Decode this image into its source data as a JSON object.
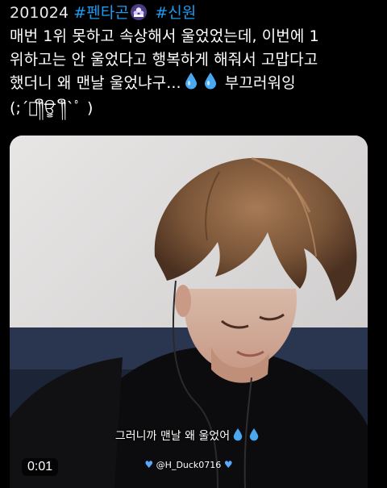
{
  "tweet": {
    "date": "201024",
    "hashtag_1": "#펜타곤",
    "hashtag_2": "#신원",
    "line_2": "매번 1위 못하고 속상해서 울었었는데, 이번에 1",
    "line_3": "위하고는 안 울었다고 행복하게 해줘서 고맙다고",
    "line_4_start": "했더니 왜 맨날 울었냐구...",
    "line_4_end": "부끄러워잉",
    "line_5": "(;´ﾟ༎ຶਊ ༎ຶ`ﾟ )",
    "badge_icon": "pentagon-universe-badge-icon",
    "drop_icon": "water-drop-emoji-icon",
    "hashtag_color": "#1d9bf0"
  },
  "video": {
    "subtitle": "그러니까 맨날 왜 울었어",
    "watermark": "@H_Duck0716",
    "heart_icon": "blue-heart-emoji",
    "elapsed": "0:01"
  }
}
